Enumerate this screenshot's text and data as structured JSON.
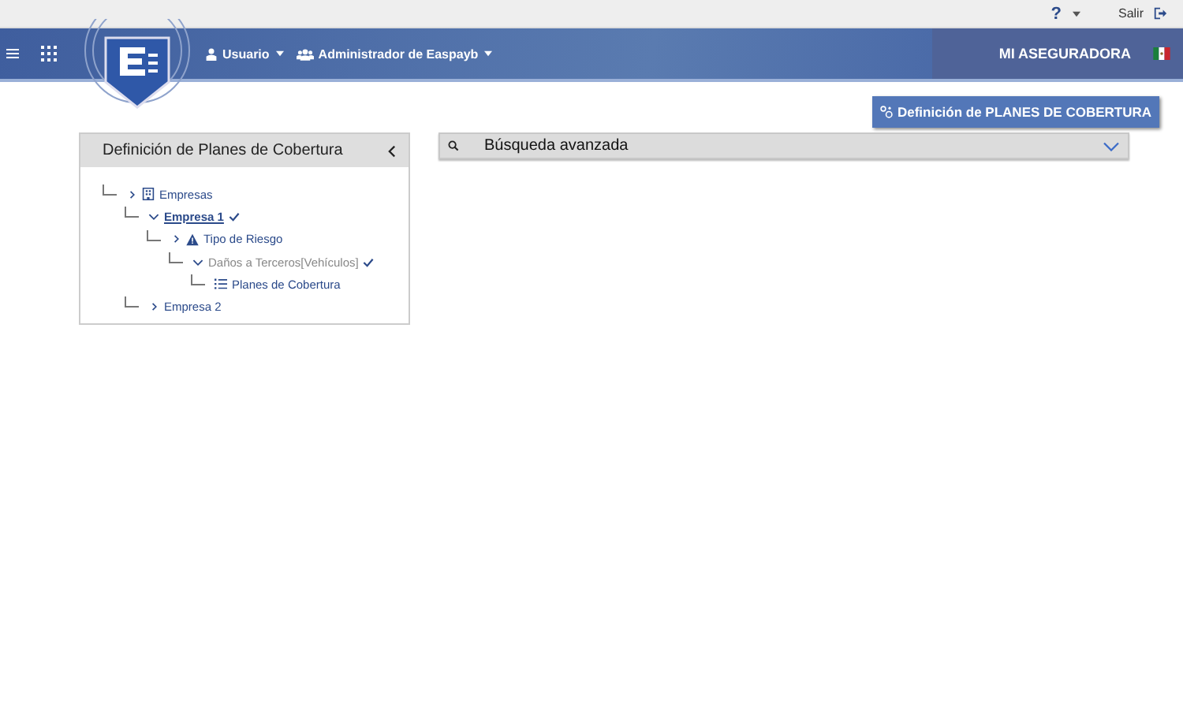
{
  "top_bar": {
    "help": "?",
    "logout": "Salir"
  },
  "nav": {
    "user_menu": "Usuario",
    "admin_menu": "Administrador de Easpayb",
    "company": "MI ASEGURADORA"
  },
  "action_button": "Definición de PLANES DE COBERTURA",
  "tree_panel": {
    "title": "Definición de Planes de Cobertura",
    "nodes": [
      {
        "label": "Empresas",
        "kind": "group",
        "expanded": false,
        "selected": false,
        "checked": false,
        "disabled": false,
        "children": [
          {
            "label": "Empresa 1",
            "expanded": true,
            "selected": true,
            "checked": true,
            "disabled": false,
            "children": [
              {
                "label": "Tipo de Riesgo",
                "kind": "risk",
                "expanded": false,
                "selected": false,
                "checked": false,
                "disabled": false,
                "children": [
                  {
                    "label": "Daños a Terceros[Vehículos]",
                    "expanded": true,
                    "selected": false,
                    "checked": true,
                    "disabled": true,
                    "children": [
                      {
                        "label": "Planes de Cobertura",
                        "kind": "plans",
                        "selected": false,
                        "checked": false,
                        "disabled": false
                      }
                    ]
                  }
                ]
              }
            ]
          },
          {
            "label": "Empresa 2",
            "expanded": false,
            "selected": false,
            "checked": false,
            "disabled": false
          }
        ]
      }
    ]
  },
  "search": {
    "title": "Búsqueda avanzada",
    "expanded": false
  }
}
